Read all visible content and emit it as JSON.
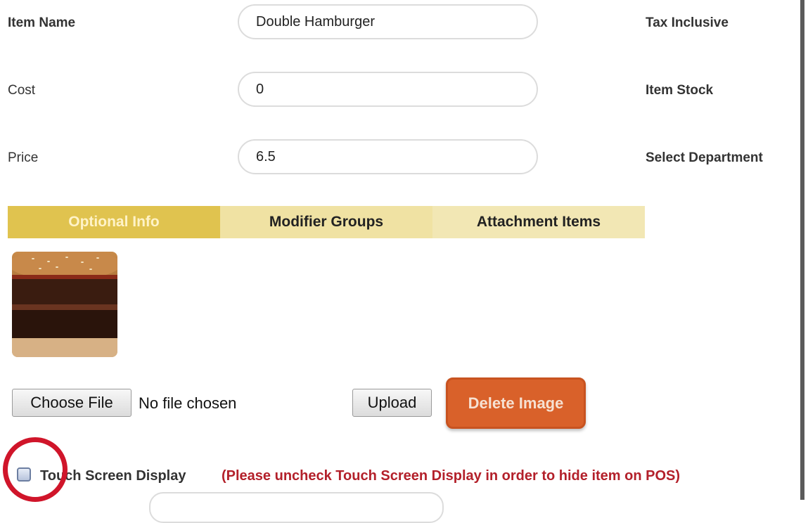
{
  "form": {
    "item_name": {
      "label": "Item Name",
      "value": "Double Hamburger"
    },
    "cost": {
      "label": "Cost",
      "value": "0"
    },
    "price": {
      "label": "Price",
      "value": "6.5"
    },
    "right_labels": {
      "tax_inclusive": "Tax Inclusive",
      "item_stock": "Item Stock",
      "select_department": "Select Department"
    }
  },
  "tabs": [
    {
      "label": "Optional Info",
      "active": true
    },
    {
      "label": "Modifier Groups",
      "active": false
    },
    {
      "label": "Attachment Items",
      "active": false
    }
  ],
  "image_section": {
    "thumbnail": "burger-photo",
    "choose_file_label": "Choose File",
    "no_file_text": "No file chosen",
    "upload_label": "Upload",
    "delete_label": "Delete Image"
  },
  "touch_screen": {
    "label": "Touch Screen Display",
    "note": "(Please uncheck Touch Screen Display in order to hide item on POS)",
    "checked": false
  },
  "colors": {
    "tab_active": "#e0c34f",
    "tab_inactive": "#f0e2a3",
    "delete_button": "#d9612a",
    "note_text": "#b3202a",
    "highlight_circle": "#d0152a"
  }
}
